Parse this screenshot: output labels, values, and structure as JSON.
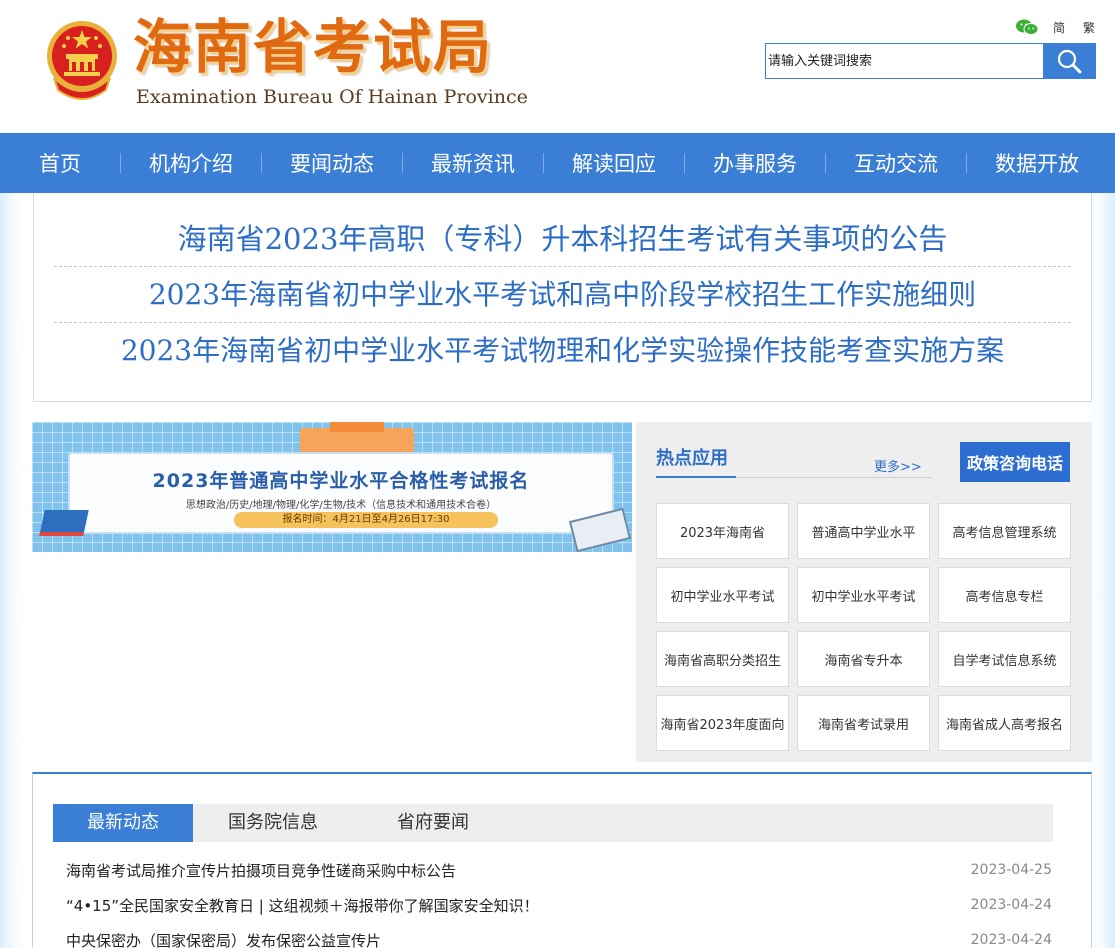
{
  "header": {
    "title": "海南省考试局",
    "subtitle": "Examination Bureau Of Hainan Province",
    "emblem_icon": "national-emblem-icon",
    "wechat_icon": "wechat-icon",
    "lang_simplified": "简",
    "lang_traditional": "繁",
    "search_placeholder": "请输入关键词搜索",
    "search_icon": "search-icon"
  },
  "colors": {
    "primary": "#3a7fd5",
    "title_orange": "#e06a12",
    "headline_blue": "#2e6ec6"
  },
  "nav": {
    "items": [
      "首页",
      "机构介绍",
      "要闻动态",
      "最新资讯",
      "解读回应",
      "办事服务",
      "互动交流",
      "数据开放"
    ]
  },
  "headlines": [
    "海南省2023年高职（专科）升本科招生考试有关事项的公告",
    "2023年海南省初中学业水平考试和高中阶段学校招生工作实施细则",
    "2023年海南省初中学业水平考试物理和化学实验操作技能考查实施方案"
  ],
  "banner": {
    "title": "2023年普通高中学业水平合格性考试报名",
    "subjects": "思想政治/历史/地理/物理/化学/生物/技术（信息技术和通用技术合卷）",
    "time": "报名时间：4月21日至4月26日17:30"
  },
  "hot_apps": {
    "title": "热点应用",
    "more": "更多>>",
    "policy_phone": "政策咨询电话",
    "items": [
      "2023年海南省",
      "普通高中学业水平",
      "高考信息管理系统",
      "初中学业水平考试",
      "初中学业水平考试",
      "高考信息专栏",
      "海南省高职分类招生",
      "海南省专升本",
      "自学考试信息系统",
      "海南省2023年度面向",
      "海南省考试录用",
      "海南省成人高考报名"
    ]
  },
  "news": {
    "tabs": [
      "最新动态",
      "国务院信息",
      "省府要闻"
    ],
    "active_tab": 0,
    "items": [
      {
        "title": "海南省考试局推介宣传片拍摄项目竞争性磋商采购中标公告",
        "date": "2023-04-25"
      },
      {
        "title": "“4•15”全民国家安全教育日 | 这组视频＋海报带你了解国家安全知识！",
        "date": "2023-04-24"
      },
      {
        "title": "中央保密办（国家保密局）发布保密公益宣传片",
        "date": "2023-04-24"
      }
    ]
  }
}
